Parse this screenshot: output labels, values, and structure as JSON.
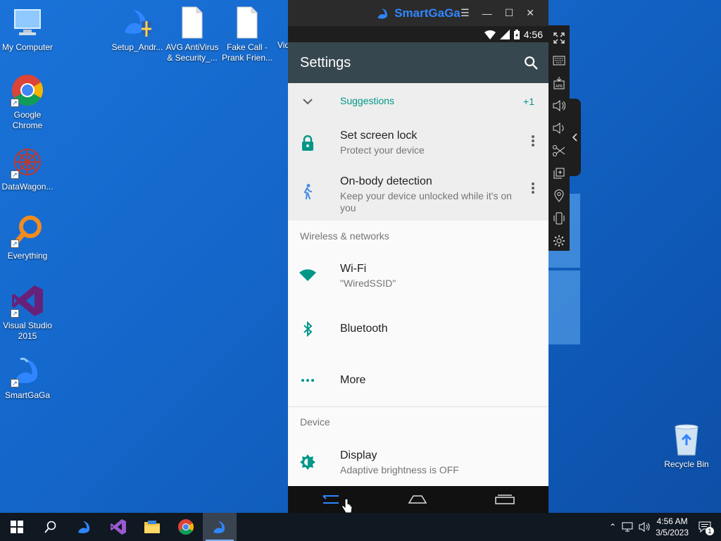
{
  "desktop": {
    "icons": [
      {
        "label": "My Computer"
      },
      {
        "label": "Google Chrome"
      },
      {
        "label": "DataWagon..."
      },
      {
        "label": "Everything"
      },
      {
        "label": "Visual Studio 2015"
      },
      {
        "label": "SmartGaGa"
      },
      {
        "label": "Setup_Andr..."
      },
      {
        "label": "AVG AntiVirus & Security_..."
      },
      {
        "label": "Fake Call - Prank Frien..."
      },
      {
        "label": "Vid"
      },
      {
        "label": "Recycle Bin"
      }
    ]
  },
  "emulator": {
    "brand": "SmartGaGa",
    "status_time": "4:56",
    "appbar_title": "Settings",
    "suggestions": {
      "label": "Suggestions",
      "count": "+1"
    },
    "suggestion_items": [
      {
        "title": "Set screen lock",
        "subtitle": "Protect your device"
      },
      {
        "title": "On-body detection",
        "subtitle": "Keep your device unlocked while it's on you"
      }
    ],
    "sections": [
      {
        "header": "Wireless & networks"
      },
      {
        "header": "Device"
      }
    ],
    "wireless_items": [
      {
        "title": "Wi-Fi",
        "subtitle": "\"WiredSSID\""
      },
      {
        "title": "Bluetooth"
      },
      {
        "title": "More"
      }
    ],
    "device_items": [
      {
        "title": "Display",
        "subtitle": "Adaptive brightness is OFF"
      }
    ]
  },
  "taskbar": {
    "time": "4:56 AM",
    "date": "3/5/2023",
    "notification_count": "1"
  },
  "colors": {
    "accent": "#009688",
    "appbar": "#37474f",
    "brand": "#2f86ff"
  }
}
